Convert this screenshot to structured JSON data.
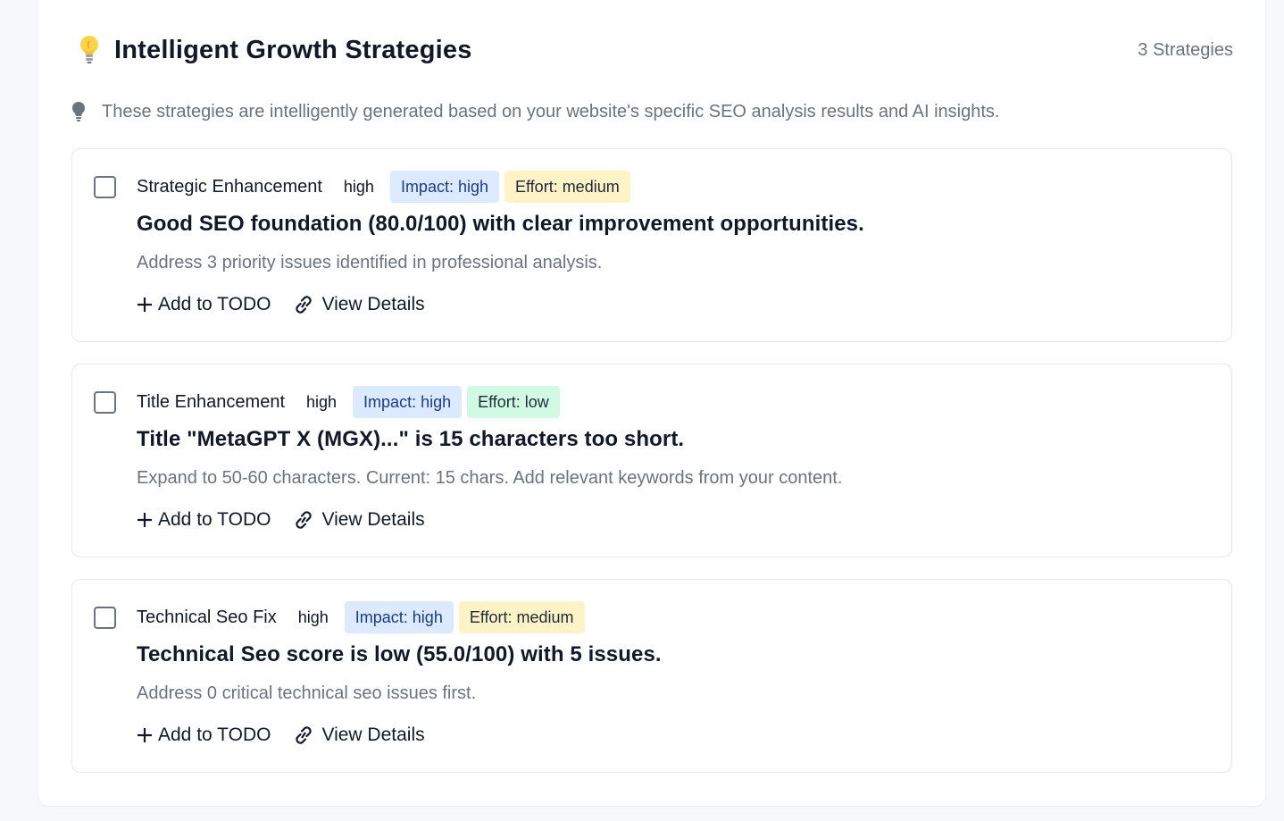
{
  "header": {
    "title": "Intelligent Growth Strategies",
    "count": "3 Strategies",
    "icon": "lightbulb-icon"
  },
  "intro": {
    "text": "These strategies are intelligently generated based on your website's specific SEO analysis results and AI insights.",
    "icon": "lightbulb-icon"
  },
  "strategies": [
    {
      "checked": false,
      "category": "Strategic Enhancement",
      "priority": "high",
      "impact": "Impact: high",
      "effort": "Effort: medium",
      "title": "Good SEO foundation (80.0/100) with clear improvement opportunities.",
      "description": "Address 3 priority issues identified in professional analysis.",
      "add_label": "Add to TODO",
      "details_label": "View Details"
    },
    {
      "checked": false,
      "category": "Title Enhancement",
      "priority": "high",
      "impact": "Impact: high",
      "effort": "Effort: low",
      "title": "Title \"MetaGPT X (MGX)...\" is 15 characters too short.",
      "description": "Expand to 50-60 characters. Current: 15 chars. Add relevant keywords from your content.",
      "add_label": "Add to TODO",
      "details_label": "View Details"
    },
    {
      "checked": false,
      "category": "Technical Seo Fix",
      "priority": "high",
      "impact": "Impact: high",
      "effort": "Effort: medium",
      "title": "Technical Seo score is low (55.0/100) with 5 issues.",
      "description": "Address 0 critical technical seo issues first.",
      "add_label": "Add to TODO",
      "details_label": "View Details"
    }
  ],
  "colors": {
    "impact_bg": "#dbeafe",
    "effort_medium_bg": "#fef3c7",
    "effort_low_bg": "#d1fae5",
    "bulb": "#fbbf24",
    "muted_text": "#6b7280"
  }
}
